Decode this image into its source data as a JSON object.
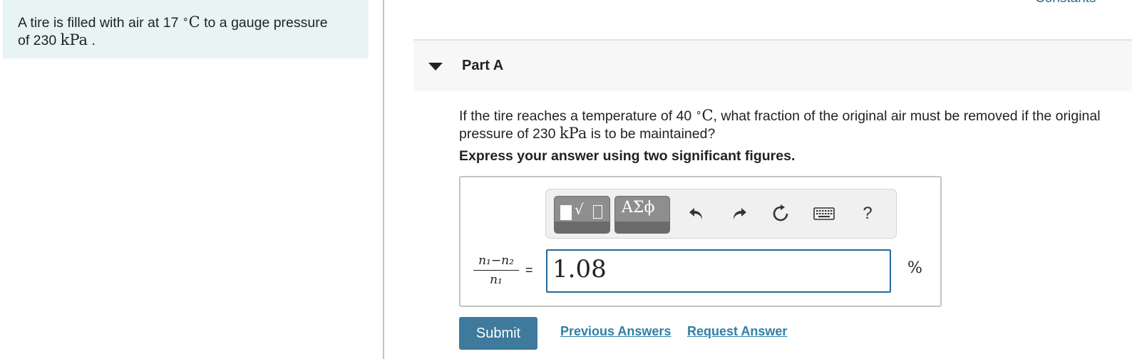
{
  "problem": {
    "line1_prefix": "A tire is filled with air at 17 ",
    "degree": "∘",
    "unit_c": "C",
    "line1_suffix": " to a gauge pressure",
    "line2_prefix": "of 230 ",
    "unit_kpa": "kPa",
    "line2_suffix": " ."
  },
  "header": {
    "constants_link": "Constants"
  },
  "part_a": {
    "title": "Part A",
    "question": {
      "prefix": "If the tire reaches a temperature of 40 ",
      "degree": "∘",
      "unit_c": "C",
      "middle": ", what fraction of the original air must be removed if the original pressure of 230 ",
      "unit_kpa": "kPa",
      "suffix": " is to be maintained?"
    },
    "instruction": "Express your answer using two significant figures.",
    "toolbar": {
      "templates_icon": "templates-icon",
      "symbols_label": "ΑΣϕ",
      "undo_icon": "undo-icon",
      "redo_icon": "redo-icon",
      "reset_icon": "reset-icon",
      "keyboard_icon": "keyboard-icon",
      "help_label": "?"
    },
    "fraction": {
      "numerator": "n₁−n₂",
      "denominator": "n₁"
    },
    "equals": "=",
    "answer_value": "1.08",
    "units": "%",
    "submit_label": "Submit",
    "previous_answers_label": "Previous Answers",
    "request_answer_label": "Request Answer"
  },
  "colors": {
    "problem_bg": "#e7f4f3",
    "link": "#2f7fa8",
    "submit_bg": "#3d7a9c",
    "input_border": "#276a96"
  }
}
